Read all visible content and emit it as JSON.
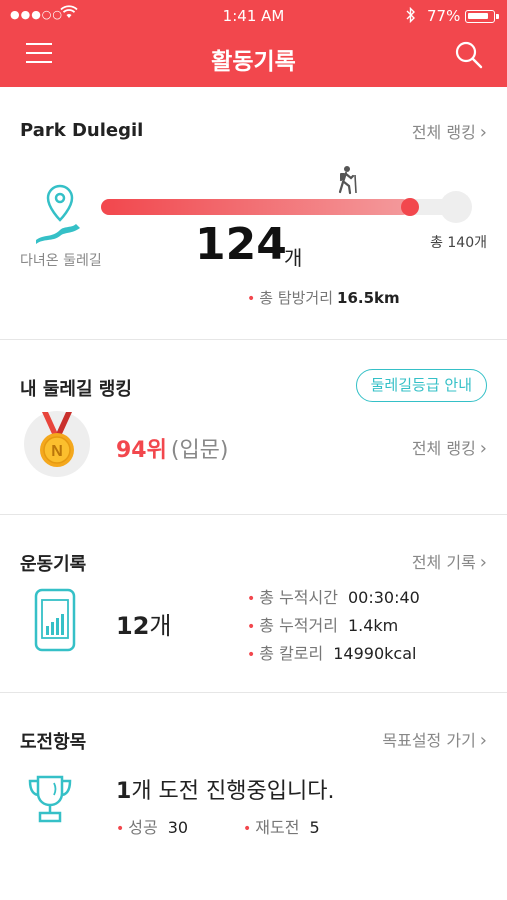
{
  "status_bar": {
    "signal": "●●●○○",
    "time": "1:41 AM",
    "battery": "77%"
  },
  "header": {
    "title": "활동기록",
    "menu_icon": "hamburger-icon",
    "search_icon": "search-icon",
    "accent_color": "#f2474d"
  },
  "park_section": {
    "title": "Park Dulegil",
    "link": "전체 랭킹",
    "walked_label": "다녀온 둘레길",
    "walked_count": "124",
    "count_unit": "개",
    "total_label": "총 140개",
    "progress_fraction": 0.886,
    "distance_label": "총 탐방거리",
    "distance_value": "16.5km"
  },
  "ranking_section": {
    "title": "내 둘레길 랭킹",
    "guide_button": "둘레길등급 안내",
    "medal_letter": "N",
    "rank": "94위",
    "grade": "(입문)",
    "link": "전체 랭킹"
  },
  "exercise_section": {
    "title": "운동기록",
    "link": "전체 기록",
    "count": "12",
    "count_unit": "개",
    "stats": [
      {
        "label": "총 누적시간",
        "value": "00:30:40"
      },
      {
        "label": "총 누적거리",
        "value": "1.4km"
      },
      {
        "label": "총 칼로리",
        "value": "14990kcal"
      }
    ]
  },
  "challenge_section": {
    "title": "도전항목",
    "link": "목표설정 가기",
    "count": "1",
    "message": "개 도전 진행중입니다.",
    "success_label": "성공",
    "success_value": "30",
    "retry_label": "재도전",
    "retry_value": "5"
  }
}
